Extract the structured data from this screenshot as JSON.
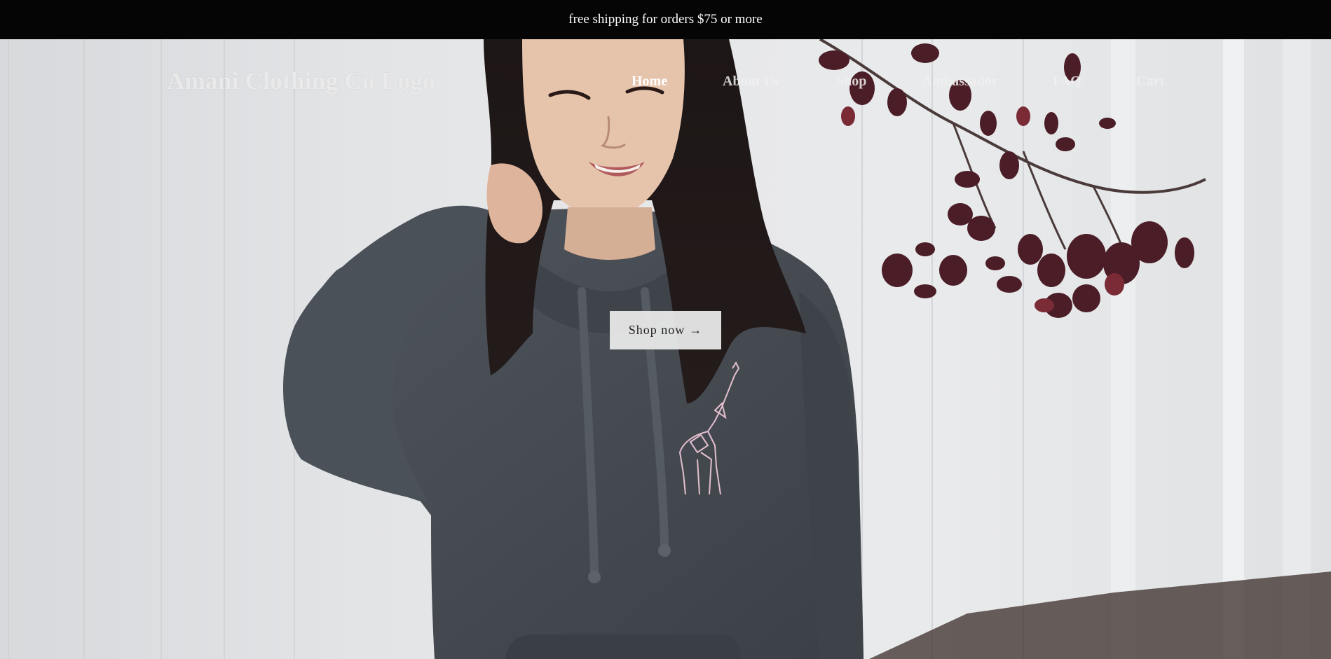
{
  "announcement": {
    "text": "free shipping for orders $75 or more"
  },
  "header": {
    "logo_text": "Amani Clothing Co Logo",
    "nav": [
      {
        "label": "Home",
        "active": true
      },
      {
        "label": "About Us",
        "active": false
      },
      {
        "label": "Shop",
        "active": false
      },
      {
        "label": "Ambassador",
        "active": false
      },
      {
        "label": "FAQ",
        "active": false
      },
      {
        "label": "Cart",
        "active": false
      }
    ]
  },
  "hero": {
    "cta_label": "Shop now",
    "cta_arrow": "→",
    "image_subject": "woman-in-charcoal-hoodie-with-giraffe-embroidery"
  },
  "colors": {
    "announcement_bg": "#050505",
    "announcement_text": "#ffffff",
    "nav_text": "#f0f0f0",
    "cta_bg": "#e8e8e8",
    "cta_text": "#222222"
  }
}
